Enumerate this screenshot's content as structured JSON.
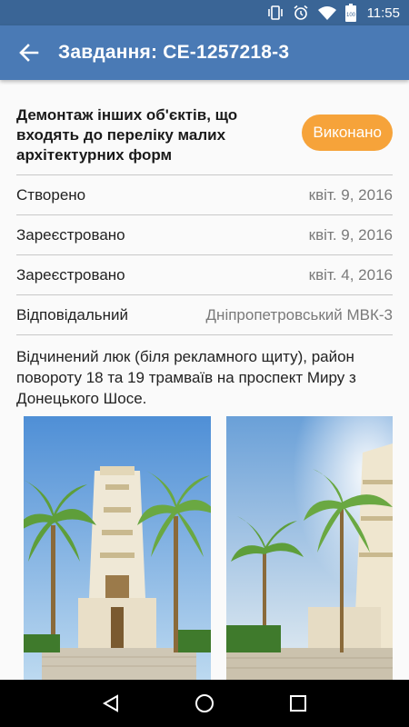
{
  "status_bar": {
    "time": "11:55",
    "battery_level": "100",
    "icons": [
      "vibrate-icon",
      "alarm-icon",
      "wifi-icon",
      "battery-icon"
    ]
  },
  "app_bar": {
    "title": "Завдання: CE-1257218-3",
    "back_icon": "arrow-back-icon"
  },
  "task": {
    "title": "Демонтаж інших об'єктів, що входять до переліку малих архітектурних форм",
    "status": "Виконано",
    "status_color": "#f6a33a"
  },
  "info": [
    {
      "label": "Створено",
      "value": "квіт. 9, 2016"
    },
    {
      "label": "Зареєстровано",
      "value": "квіт. 9, 2016"
    },
    {
      "label": "Зареєстровано",
      "value": "квіт. 4, 2016"
    },
    {
      "label": "Відповідальний",
      "value": "Дніпропетровський МВК-3"
    }
  ],
  "description": "Відчинений люк (біля рекламного щиту), район повороту 18 та 19 трамваїв на проспект Миру з Донецького Шосе.",
  "photos": [
    "temple-photo",
    "temple-palms-photo"
  ],
  "nav_bar": {
    "icons": [
      "back-triangle-icon",
      "home-circle-icon",
      "recents-square-icon"
    ]
  },
  "colors": {
    "app_bar": "#4a7ab5",
    "status_bar": "#3a6596",
    "accent": "#f6a33a"
  }
}
